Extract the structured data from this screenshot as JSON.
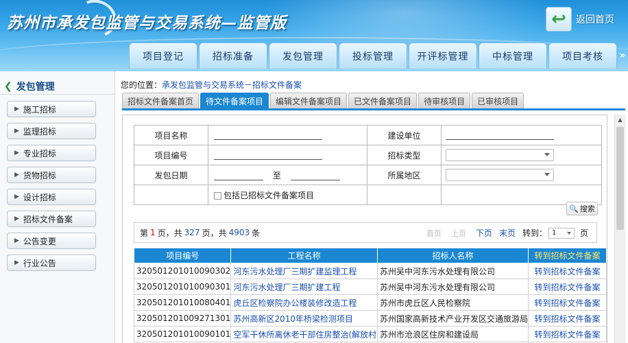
{
  "header": {
    "title": "苏州市承发包监管与交易系统—监管版",
    "home_label": "返回首页"
  },
  "nav": {
    "tabs": [
      "项目登记",
      "招标准备",
      "发包管理",
      "投标管理",
      "开评标管理",
      "中标管理",
      "项目考核"
    ],
    "more": "»"
  },
  "sidebar": {
    "title": "发包管理",
    "items": [
      "施工招标",
      "监理招标",
      "专业招标",
      "货物招标",
      "设计招标",
      "招标文件备案",
      "公告变更",
      "行业公告"
    ]
  },
  "breadcrumb": {
    "prefix": "您的位置：",
    "path": "承发包监管与交易系统－招标文件备案"
  },
  "subtabs": {
    "items": [
      "招标文件备案首页",
      "待文件备案项目",
      "编辑文件备案项目",
      "已文件备案项目",
      "待审核项目",
      "已审核项目"
    ],
    "active": "待文件备案项目"
  },
  "form": {
    "project_name": "项目名称",
    "builder": "建设单位",
    "project_code": "项目编号",
    "bid_type": "招标类型",
    "issue_date": "发包日期",
    "to": "至",
    "region": "所属地区",
    "include_label": "包括已招标文件备案项目"
  },
  "search_button": "搜索",
  "pager": {
    "p1": "第",
    "current_page": "1",
    "p2": "页，共",
    "total_pages": "327",
    "p3": "页，共",
    "total_records": "4903",
    "p4": "条",
    "first": "首页",
    "prev": "上页",
    "next": "下页",
    "last": "末页",
    "goto_label": "转到：",
    "goto_value": "1",
    "page_unit": "页"
  },
  "table": {
    "headers": [
      "项目编号",
      "工程名称",
      "招标人名称",
      "转到招标文件备案"
    ],
    "rows": [
      {
        "code": "320501201010090302",
        "name": "河东污水处理厂三期扩建监理工程",
        "unit": "苏州吴中河东污水处理有限公司",
        "action": "转到招标文件备案"
      },
      {
        "code": "320501201010090301",
        "name": "河东污水处理厂三期扩建工程",
        "unit": "苏州吴中河东污水处理有限公司",
        "action": "转到招标文件备案"
      },
      {
        "code": "320501201010080401",
        "name": "虎丘区检察院办公楼装修改造工程",
        "unit": "苏州市虎丘区人民检察院",
        "action": "转到招标文件备案"
      },
      {
        "code": "320501201009271301",
        "name": "苏州高新区2010年桥梁检测项目",
        "unit": "苏州国家高新技术产业开发区交通旅游局",
        "action": "转到招标文件备案"
      },
      {
        "code": "320501201010090101",
        "name": "空军干休所离休老干部住房整治(解放村",
        "unit": "苏州市沧浪区住房和建设局",
        "action": "转到招标文件备案"
      }
    ]
  }
}
